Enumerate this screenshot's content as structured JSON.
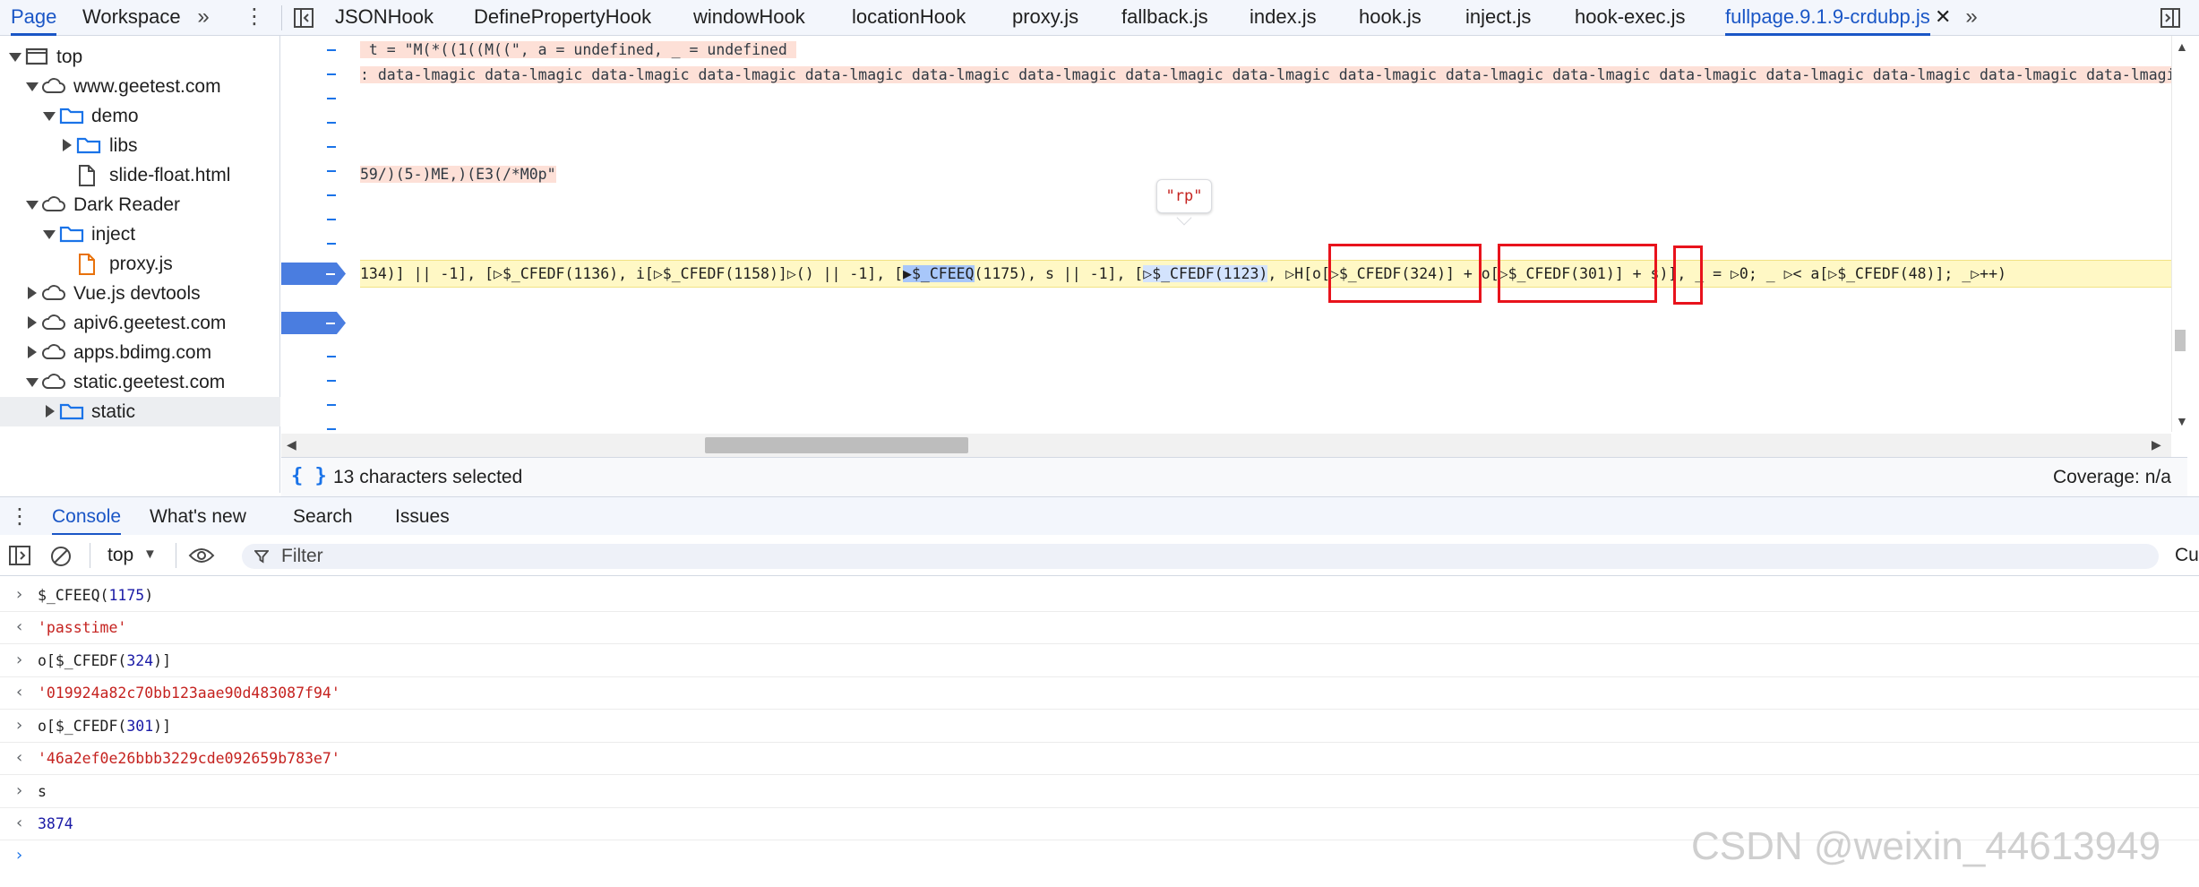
{
  "nav_tabs": {
    "page": "Page",
    "workspace": "Workspace"
  },
  "file_tabs": [
    "JSONHook",
    "DefinePropertyHook",
    "windowHook",
    "locationHook",
    "proxy.js",
    "fallback.js",
    "index.js",
    "hook.js",
    "inject.js",
    "hook-exec.js"
  ],
  "active_file_tab": "fullpage.9.1.9-crdubp.js",
  "file_tree": [
    {
      "label": "top"
    },
    {
      "label": "www.geetest.com"
    },
    {
      "label": "demo"
    },
    {
      "label": "libs"
    },
    {
      "label": "slide-float.html"
    },
    {
      "label": "Dark Reader"
    },
    {
      "label": "inject"
    },
    {
      "label": "proxy.js"
    },
    {
      "label": "Vue.js devtools"
    },
    {
      "label": "apiv6.geetest.com"
    },
    {
      "label": "apps.bdimg.com"
    },
    {
      "label": "static.geetest.com"
    },
    {
      "label": "static"
    }
  ],
  "code": {
    "line1": " t = \"M(*((1((M((\", a = undefined, _ = undefined ",
    "line2": ": data-lmagic data-lmagic data-lmagic data-lmagic data-lmagic data-lmagic data-lmagic data-lmagic data-lmagic data-lmagic data-lmagic data-lmagic data-lmagic data-lmagic data-lmagic data-lmagic data-lmagic",
    "line3": "59/)(5-)ME,)(E3(/*M0p\"",
    "exec_a": "134)] || -1], [",
    "exec_b": "$_CFEDF(1136), i[",
    "exec_c": "$_CFEDF(1158)]",
    "exec_d": "() || -1], [",
    "exec_e": "$_CFEEQ",
    "exec_f": "(1175), s || -1], [",
    "exec_g": "$_CFEDF(1123)",
    "exec_h": ", ",
    "exec_i": "H[o[",
    "exec_j": "$_CFEDF(324)",
    "exec_k": "] + o[",
    "exec_l": "$_CFEDF(301)",
    "exec_m": "] + s)], _ = ",
    "exec_n": "0; _ ",
    "exec_o": "< a[",
    "exec_p": "$_CFEDF(48)]; _",
    "exec_q": "++)",
    "tooltip": "\"rp\""
  },
  "editor_footer": {
    "selection": "13 characters selected",
    "coverage": "Coverage: n/a"
  },
  "drawer_tabs": [
    "Console",
    "What's new",
    "Search",
    "Issues"
  ],
  "console_toolbar": {
    "context": "top",
    "filter_placeholder": "Filter",
    "cut_label": "Cu"
  },
  "console": [
    {
      "kind": "input",
      "text": "$_CFEEQ(",
      "num": "1175",
      "tail": ")"
    },
    {
      "kind": "output",
      "text": "'passtime'"
    },
    {
      "kind": "input",
      "text": "o[$_CFEDF(",
      "num": "324",
      "tail": ")]"
    },
    {
      "kind": "output",
      "text": "'019924a82c70bb123aae90d483087f94'"
    },
    {
      "kind": "input",
      "text": "o[$_CFEDF(",
      "num": "301",
      "tail": ")]"
    },
    {
      "kind": "output",
      "text": "'46a2ef0e26bbb3229cde092659b783e7'"
    },
    {
      "kind": "input",
      "text": "s",
      "num": "",
      "tail": ""
    },
    {
      "kind": "output_num",
      "text": "3874"
    }
  ],
  "watermark": "CSDN @weixin_44613949",
  "colors": {
    "accent": "#1a56c6",
    "exec_line": "#fff8c5",
    "highlight_box": "#e8131c"
  }
}
